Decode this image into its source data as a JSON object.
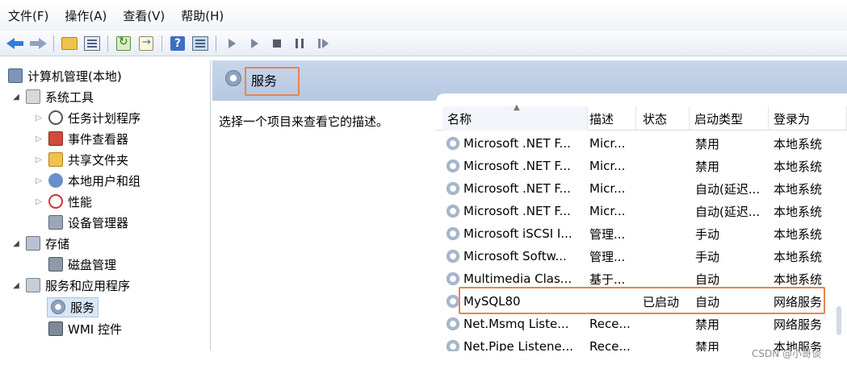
{
  "menu": [
    "文件(F)",
    "操作(A)",
    "查看(V)",
    "帮助(H)"
  ],
  "tree": {
    "root": "计算机管理(本地)",
    "system_tools": "系统工具",
    "task_scheduler": "任务计划程序",
    "event_viewer": "事件查看器",
    "shared_folders": "共享文件夹",
    "local_users": "本地用户和组",
    "performance": "性能",
    "device_manager": "设备管理器",
    "storage": "存储",
    "disk_management": "磁盘管理",
    "services_apps": "服务和应用程序",
    "services": "服务",
    "wmi": "WMI 控件"
  },
  "pane": {
    "title": "服务",
    "description": "选择一个项目来查看它的描述。"
  },
  "table": {
    "columns": [
      "名称",
      "描述",
      "状态",
      "启动类型",
      "登录为"
    ],
    "rows": [
      {
        "name": "Microsoft .NET F...",
        "desc": "Micr...",
        "status": "",
        "startup": "禁用",
        "logon": "本地系统"
      },
      {
        "name": "Microsoft .NET F...",
        "desc": "Micr...",
        "status": "",
        "startup": "禁用",
        "logon": "本地系统"
      },
      {
        "name": "Microsoft .NET F...",
        "desc": "Micr...",
        "status": "",
        "startup": "自动(延迟...",
        "logon": "本地系统"
      },
      {
        "name": "Microsoft .NET F...",
        "desc": "Micr...",
        "status": "",
        "startup": "自动(延迟...",
        "logon": "本地系统"
      },
      {
        "name": "Microsoft iSCSI I...",
        "desc": "管理...",
        "status": "",
        "startup": "手动",
        "logon": "本地系统"
      },
      {
        "name": "Microsoft Softw...",
        "desc": "管理...",
        "status": "",
        "startup": "手动",
        "logon": "本地系统"
      },
      {
        "name": "Multimedia Clas...",
        "desc": "基于...",
        "status": "",
        "startup": "自动",
        "logon": "本地系统"
      },
      {
        "name": "MySQL80",
        "desc": "",
        "status": "已启动",
        "startup": "自动",
        "logon": "网络服务"
      },
      {
        "name": "Net.Msmq Liste...",
        "desc": "Rece...",
        "status": "",
        "startup": "禁用",
        "logon": "网络服务"
      },
      {
        "name": "Net.Pipe Listene...",
        "desc": "Rece...",
        "status": "",
        "startup": "禁用",
        "logon": "本地服务"
      }
    ]
  },
  "watermark": "CSDN @小哥谈",
  "colors": {
    "highlight": "#e8844f",
    "header_bg": "#c8d6ea",
    "selection": "#d8e6f7"
  }
}
